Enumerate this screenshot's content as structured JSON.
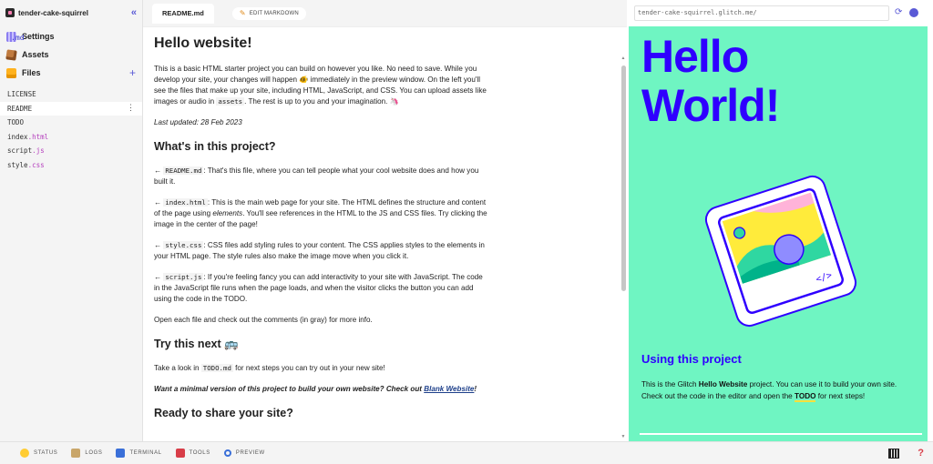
{
  "sidebar": {
    "project_name": "tender-cake-squirrel",
    "collapse_glyph": "«",
    "nav": [
      {
        "label": "Settings",
        "icon": "settings-icon"
      },
      {
        "label": "Assets",
        "icon": "assets-icon"
      },
      {
        "label": "Files",
        "icon": "files-icon"
      }
    ],
    "add_glyph": "+",
    "files": [
      {
        "name": "LICENSE",
        "ext": "",
        "active": false
      },
      {
        "name": "README",
        "ext": ".md",
        "active": true
      },
      {
        "name": "TODO",
        "ext": ".md",
        "active": false
      },
      {
        "name": "index",
        "ext": ".html",
        "active": false
      },
      {
        "name": "script",
        "ext": ".js",
        "active": false
      },
      {
        "name": "style",
        "ext": ".css",
        "active": false
      }
    ],
    "more_glyph": "⋮"
  },
  "editor": {
    "tab_label": "README.md",
    "edit_markdown_label": "EDIT MARKDOWN",
    "h1": "Hello website!",
    "intro_1": "This is a basic HTML starter project you can build on however you like. No need to save. While you develop your site, your changes will happen ",
    "intro_2": " immediately in the preview window. On the left you'll see the files that make up your site, including HTML, JavaScript, and CSS. You can upload assets like images or audio in ",
    "intro_code": "assets",
    "intro_3": ". The rest is up to you and your imagination. ",
    "last_updated": "Last updated: 28 Feb 2023",
    "h2_project": "What's in this project?",
    "arrow": "←",
    "items": [
      {
        "code": "README.md",
        "text": ": That's this file, where you can tell people what your cool website does and how you built it."
      },
      {
        "code": "index.html",
        "text_1": ": This is the main web page for your site. The HTML defines the structure and content of the page using ",
        "em": "elements",
        "text_2": ". You'll see references in the HTML to the JS and CSS files. Try clicking the image in the center of the page!"
      },
      {
        "code": "style.css",
        "text": ": CSS files add styling rules to your content. The CSS applies styles to the elements in your HTML page. The style rules also make the image move when you click it."
      },
      {
        "code": "script.js",
        "text": ": If you're feeling fancy you can add interactivity to your site with JavaScript. The code in the JavaScript file runs when the page loads, and when the visitor clicks the button you can add using the code in the TODO."
      }
    ],
    "open_each": "Open each file and check out the comments (in gray) for more info.",
    "h2_next": "Try this next",
    "next_1": "Take a look in ",
    "next_code": "TODO.md",
    "next_2": " for next steps you can try out in your new site!",
    "minimal_text": "Want a minimal version of this project to build your own website? Check out ",
    "minimal_link": "Blank Website",
    "minimal_end": "!",
    "h2_share": "Ready to share your site?"
  },
  "preview": {
    "url": "tender-cake-squirrel.glitch.me/",
    "hello": "Hello World!",
    "heading": "Using this project",
    "desc_1": "This is the Glitch ",
    "desc_bold": "Hello Website",
    "desc_2": " project. You can use it to build your own site. Check out the code in the editor and open the ",
    "desc_todo": "TODO",
    "desc_3": " for next steps!",
    "bg_color": "#6ff5c2",
    "accent": "#2f00ff"
  },
  "bottom_bar": {
    "items": [
      {
        "label": "STATUS",
        "icon": "status-icon"
      },
      {
        "label": "LOGS",
        "icon": "logs-icon"
      },
      {
        "label": "TERMINAL",
        "icon": "terminal-icon"
      },
      {
        "label": "TOOLS",
        "icon": "tools-icon"
      },
      {
        "label": "PREVIEW",
        "icon": "preview-icon"
      }
    ],
    "help_glyph": "?"
  }
}
